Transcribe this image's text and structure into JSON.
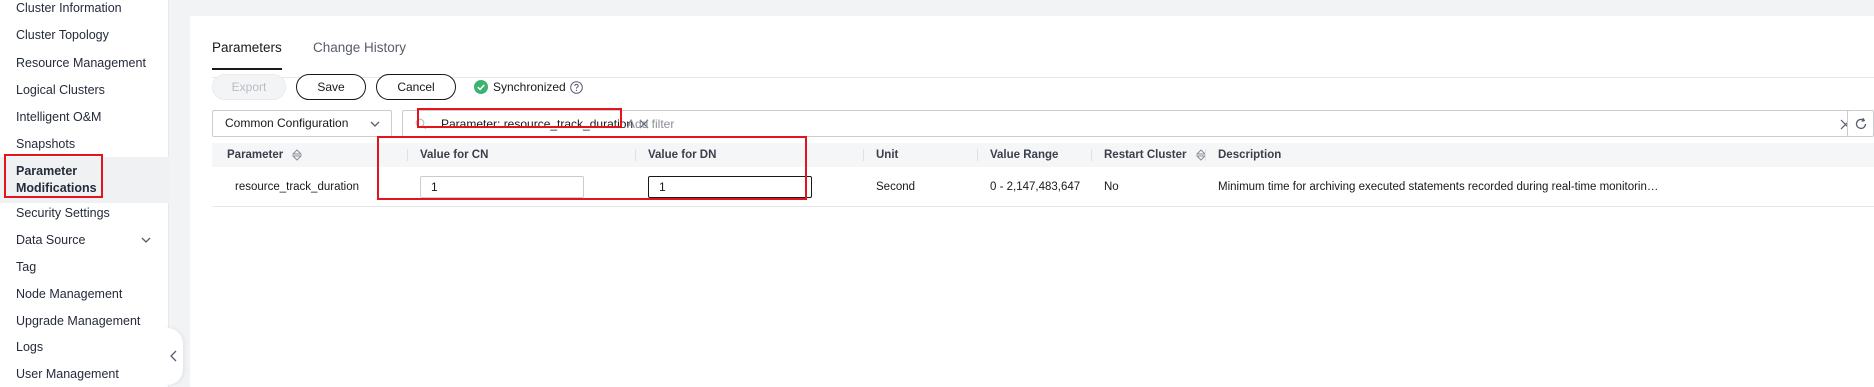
{
  "sidebar": {
    "items": [
      {
        "label": "Cluster Information"
      },
      {
        "label": "Cluster Topology"
      },
      {
        "label": "Resource Management"
      },
      {
        "label": "Logical Clusters"
      },
      {
        "label": "Intelligent O&M"
      },
      {
        "label": "Snapshots"
      },
      {
        "label": "Parameter Modifications",
        "active": true
      },
      {
        "label": "Security Settings"
      },
      {
        "label": "Data Source",
        "expandable": true
      },
      {
        "label": "Tag"
      },
      {
        "label": "Node Management"
      },
      {
        "label": "Upgrade Management"
      },
      {
        "label": "Logs"
      },
      {
        "label": "User Management"
      }
    ]
  },
  "tabs": [
    {
      "label": "Parameters",
      "active": true
    },
    {
      "label": "Change History"
    }
  ],
  "toolbar": {
    "export_label": "Export",
    "save_label": "Save",
    "cancel_label": "Cancel",
    "status_label": "Synchronized"
  },
  "filters": {
    "config_select": "Common Configuration",
    "chip_label": "Parameter: resource_track_duration",
    "placeholder": "Add filter"
  },
  "table": {
    "columns": [
      "Parameter",
      "Value for CN",
      "Value for DN",
      "Unit",
      "Value Range",
      "Restart Cluster",
      "Description"
    ],
    "rows": [
      {
        "parameter": "resource_track_duration",
        "value_cn": "1",
        "value_dn": "1",
        "unit": "Second",
        "value_range": "0 - 2,147,483,647",
        "restart": "No",
        "description": "Minimum time for archiving executed statements recorded during real-time monitoring. If yo..."
      }
    ]
  },
  "colors": {
    "accent": "#191919",
    "success": "#3cb371",
    "highlight": "#e4141e"
  },
  "icons": [
    "chevron-down-icon",
    "chevron-left-icon",
    "check-circle-icon",
    "help-icon",
    "search-icon",
    "close-icon",
    "refresh-icon",
    "sort-icon"
  ]
}
